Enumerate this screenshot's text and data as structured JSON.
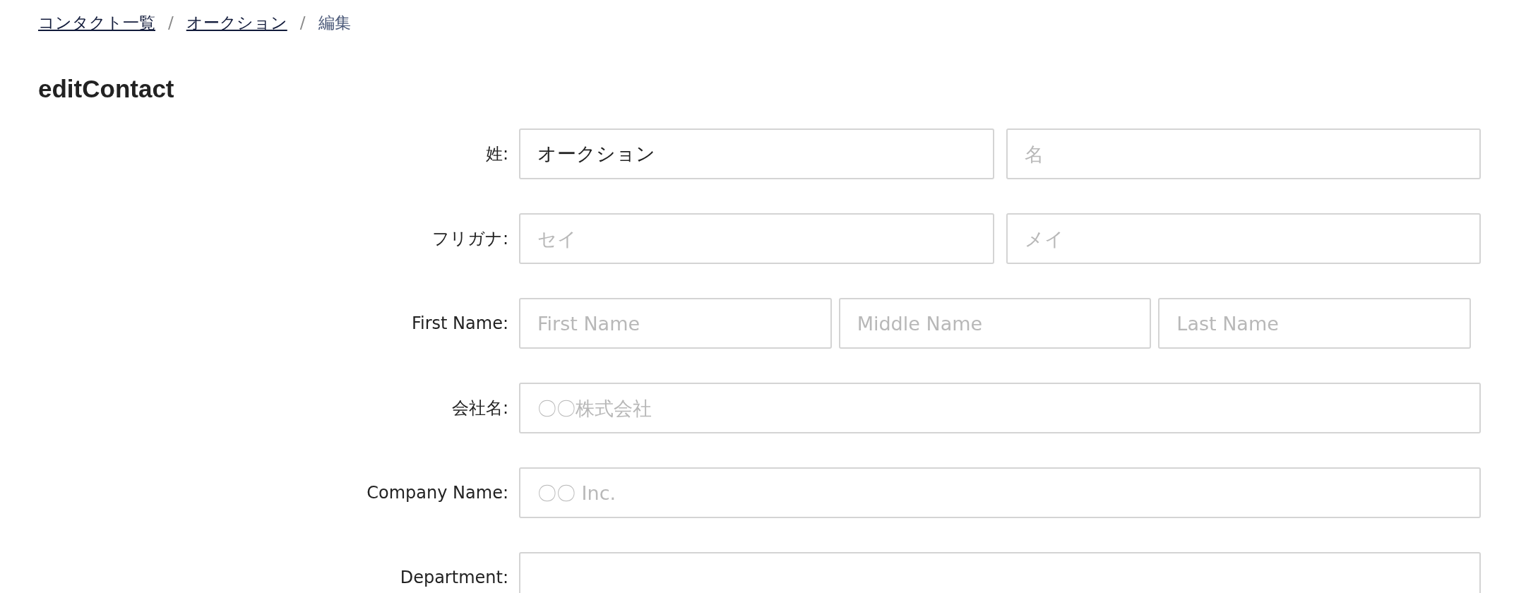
{
  "breadcrumb": [
    {
      "label": "コンタクト一覧",
      "kind": "link"
    },
    {
      "label": "オークション ",
      "kind": "link"
    },
    {
      "label": "編集",
      "kind": "current"
    }
  ],
  "separators": [
    "/",
    "/"
  ],
  "title": "editContact",
  "rows": [
    {
      "label": "姓:",
      "fields": [
        {
          "kind": "text",
          "value": "オークション"
        },
        {
          "kind": "text",
          "placeholder": "名"
        }
      ]
    },
    {
      "label": "フリガナ:",
      "fields": [
        {
          "kind": "text",
          "placeholder": "セイ"
        },
        {
          "kind": "text",
          "placeholder": "メイ"
        }
      ]
    },
    {
      "label": "First Name:",
      "fields": [
        {
          "kind": "text",
          "placeholder": "First Name"
        },
        {
          "kind": "text",
          "placeholder": "Middle Name"
        },
        {
          "kind": "text",
          "placeholder": "Last Name"
        }
      ]
    },
    {
      "label": "会社名:",
      "fields": [
        {
          "kind": "text",
          "placeholder": "〇〇株式会社"
        }
      ]
    },
    {
      "label": "Company Name:",
      "fields": [
        {
          "kind": "text",
          "placeholder": "〇〇 Inc."
        }
      ]
    },
    {
      "label": "Department:",
      "fields": [
        {
          "kind": "text"
        }
      ]
    }
  ]
}
